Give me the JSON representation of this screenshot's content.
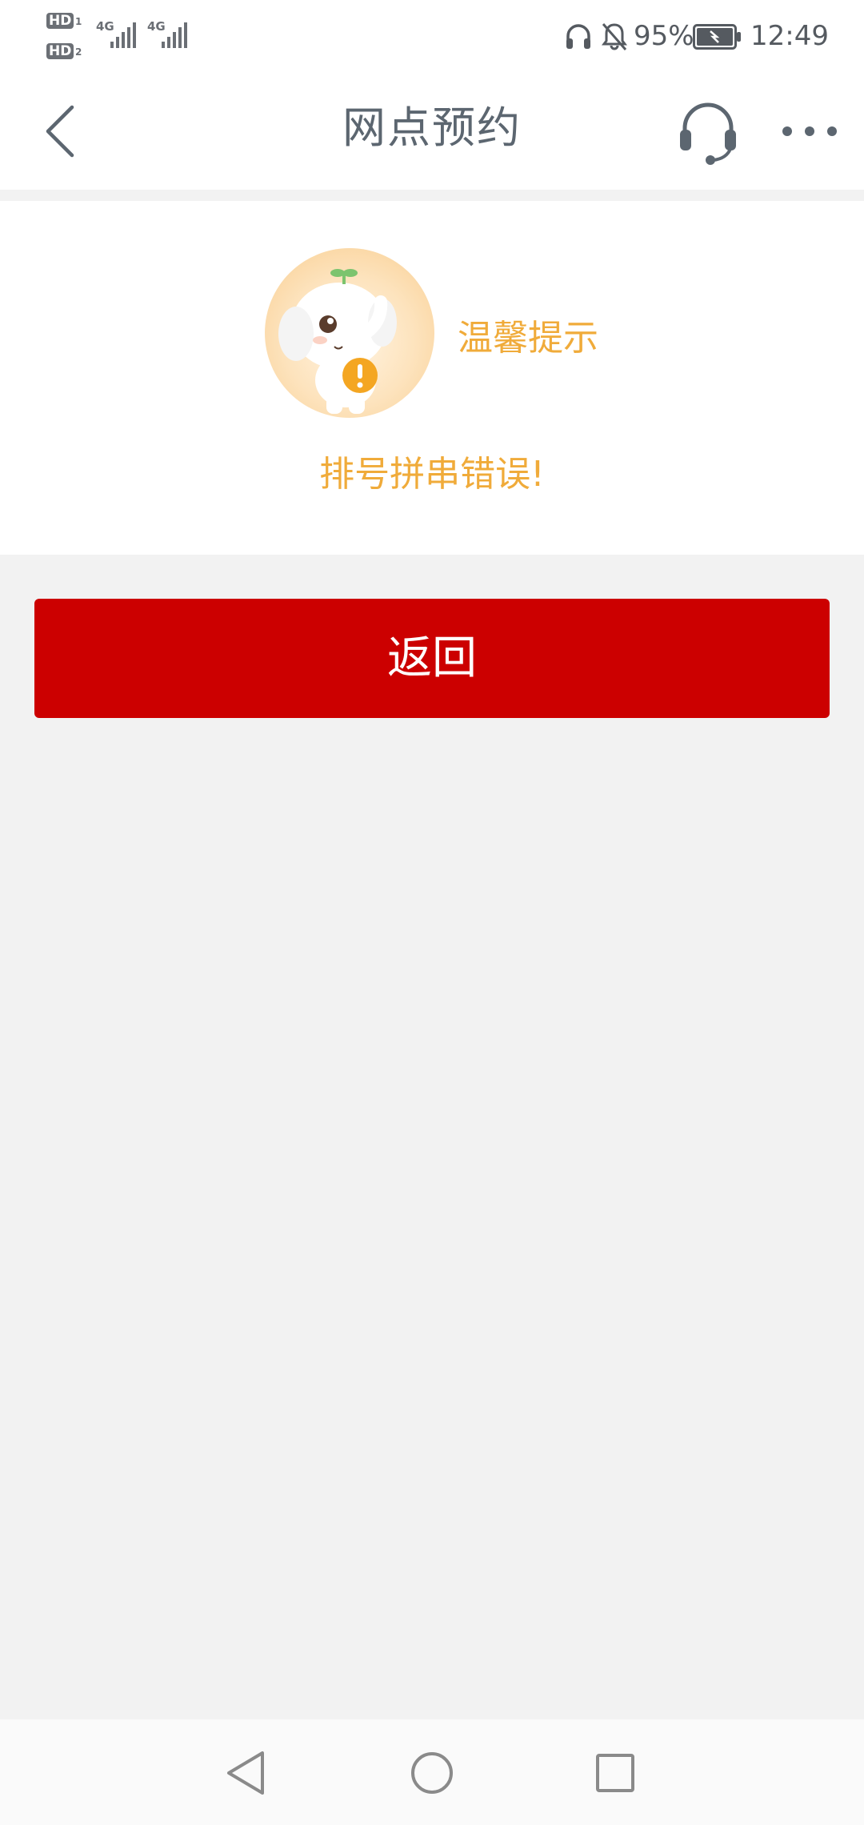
{
  "status_bar": {
    "sim1_badge": "HD",
    "sim1_index": "1",
    "sim2_badge": "HD",
    "sim2_index": "2",
    "network1": "4G",
    "network2": "4G",
    "battery_percent": "95%",
    "time": "12:49",
    "icons": [
      "headphones-icon",
      "mute-bell-icon",
      "battery-icon"
    ]
  },
  "header": {
    "title": "网点预约",
    "back_icon": "chevron-left-icon",
    "service_icon": "headset-icon",
    "more_icon": "more-dots-icon"
  },
  "notice": {
    "title": "温馨提示",
    "message": "排号拼串错误!",
    "mascot": "elephant-mascot-warning"
  },
  "actions": {
    "return_label": "返回"
  },
  "nav_bar": {
    "icons": [
      "nav-back-icon",
      "nav-home-icon",
      "nav-recents-icon"
    ]
  },
  "colors": {
    "accent_red": "#cc0000",
    "notice_orange": "#f0ab3a",
    "title_gray": "#5c6670",
    "page_bg": "#f2f2f2"
  }
}
